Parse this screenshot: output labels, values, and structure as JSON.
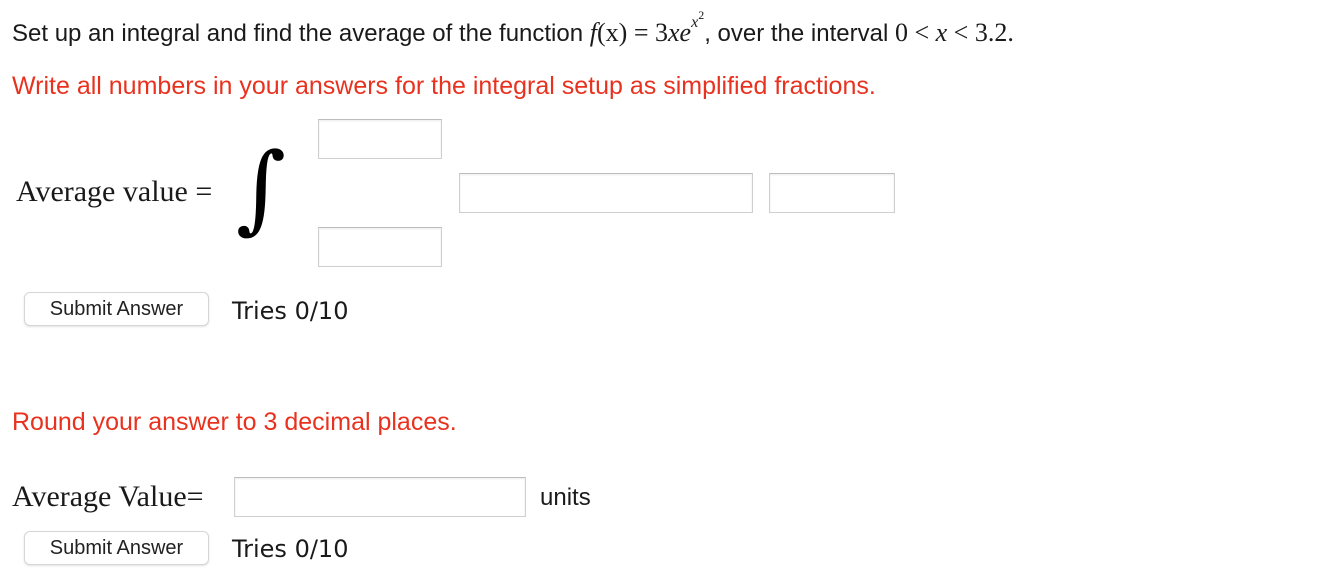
{
  "question": {
    "prefix": "Set up an integral and find the average of the function",
    "func_name": "f",
    "func_var": "(x)",
    "equals": "=",
    "coefficient": "3",
    "variable": "x",
    "base": "e",
    "exponent_base": "x",
    "exponent_power": "2",
    "middle": ", over the interval",
    "interval_lower": "0",
    "less_than_1": "<",
    "interval_var": "x",
    "less_than_2": "<",
    "interval_upper": "3.2."
  },
  "part1": {
    "instruction": "Write all numbers in your answers for the integral setup as simplified fractions.",
    "label": "Average value =",
    "integral_symbol": "∫",
    "upper_limit": {
      "value": "",
      "placeholder": ""
    },
    "lower_limit": {
      "value": "",
      "placeholder": ""
    },
    "integrand": {
      "value": "",
      "placeholder": ""
    },
    "differential": {
      "value": "",
      "placeholder": ""
    },
    "submit_label": "Submit Answer",
    "tries": "Tries 0/10"
  },
  "part2": {
    "instruction": "Round your answer to 3 decimal places.",
    "label": "Average Value=",
    "answer": {
      "value": "",
      "placeholder": ""
    },
    "units": "units",
    "submit_label": "Submit Answer",
    "tries": "Tries 0/10"
  },
  "colors": {
    "instruction_red": "#e8321f",
    "text": "#1a1a1a",
    "border": "#cfcfcf"
  }
}
